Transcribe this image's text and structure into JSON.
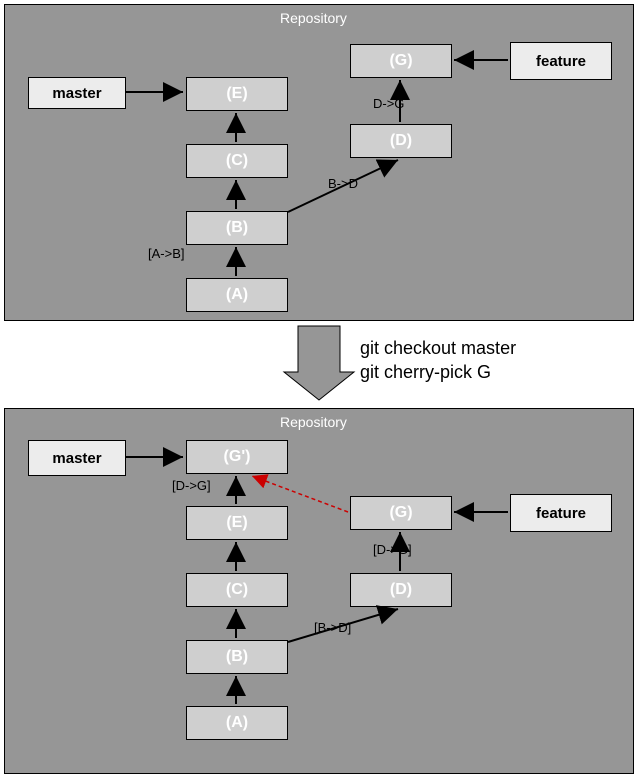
{
  "panels": {
    "top": {
      "title": "Repository"
    },
    "bottom": {
      "title": "Repository"
    }
  },
  "branches": {
    "master": "master",
    "feature": "feature"
  },
  "top": {
    "nodes": {
      "g": "(G)",
      "e": "(E)",
      "c": "(C)",
      "d": "(D)",
      "b": "(B)",
      "a": "(A)"
    },
    "edges": {
      "dg": "D->G",
      "bd": "B->D",
      "ab": "[A->B]"
    }
  },
  "bottom": {
    "nodes": {
      "gp": "(G')",
      "e": "(E)",
      "g": "(G)",
      "c": "(C)",
      "d": "(D)",
      "b": "(B)",
      "a": "(A)"
    },
    "edges": {
      "dg1": "[D->G]",
      "dg2": "[D->G]",
      "bd": "[B->D]"
    }
  },
  "commands": {
    "line1": "git checkout master",
    "line2": "git cherry-pick G"
  }
}
